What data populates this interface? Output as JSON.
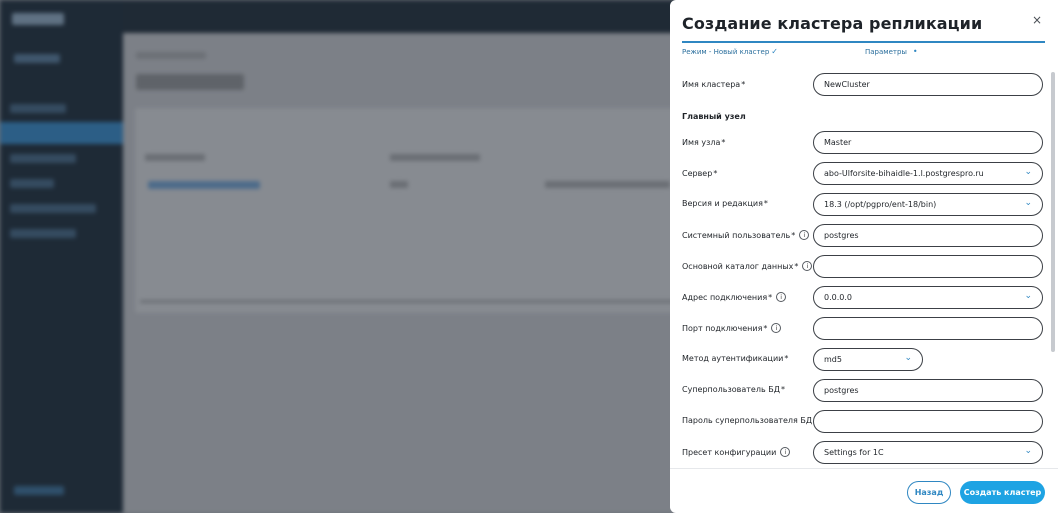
{
  "modal": {
    "title": "Создание кластера репликации",
    "close_glyph": "×",
    "steps": [
      {
        "label": "Режим - Новый кластер",
        "status": "done"
      },
      {
        "label": "Параметры",
        "status": "current"
      }
    ],
    "fields": {
      "cluster_name": {
        "label": "Имя кластера",
        "value": "NewCluster"
      },
      "section_main_node": "Главный узел",
      "node_name": {
        "label": "Имя узла",
        "value": "Master"
      },
      "server": {
        "label": "Сервер",
        "value": "abo-Ulforsite-bihaidle-1.l.postgrespro.ru"
      },
      "version": {
        "label": "Версия и редакция",
        "value": "18.3 (/opt/pgpro/ent-18/bin)"
      },
      "system_user": {
        "label": "Системный пользователь",
        "value": "postgres"
      },
      "data_dir": {
        "label": "Основной каталог данных",
        "value": ""
      },
      "conn_address": {
        "label": "Адрес подключения",
        "value": "0.0.0.0"
      },
      "conn_port": {
        "label": "Порт подключения",
        "value": ""
      },
      "auth_method": {
        "label": "Метод аутентификации",
        "value": "md5"
      },
      "db_superuser": {
        "label": "Суперпользователь БД",
        "value": "postgres"
      },
      "db_superuser_password": {
        "label": "Пароль суперпользователя БД",
        "value": ""
      },
      "config_preset": {
        "label": "Пресет конфигурации",
        "value": "Settings for 1C"
      }
    },
    "required_mark": "*",
    "info_glyph": "i",
    "chevron_glyph": "⌄",
    "check_glyph": "✓",
    "dot_glyph": "•",
    "buttons": {
      "back": "Назад",
      "create": "Создать кластер"
    },
    "colors": {
      "accent": "#1ea3e3",
      "link": "#2f87c2",
      "text": "#1f2328"
    }
  }
}
